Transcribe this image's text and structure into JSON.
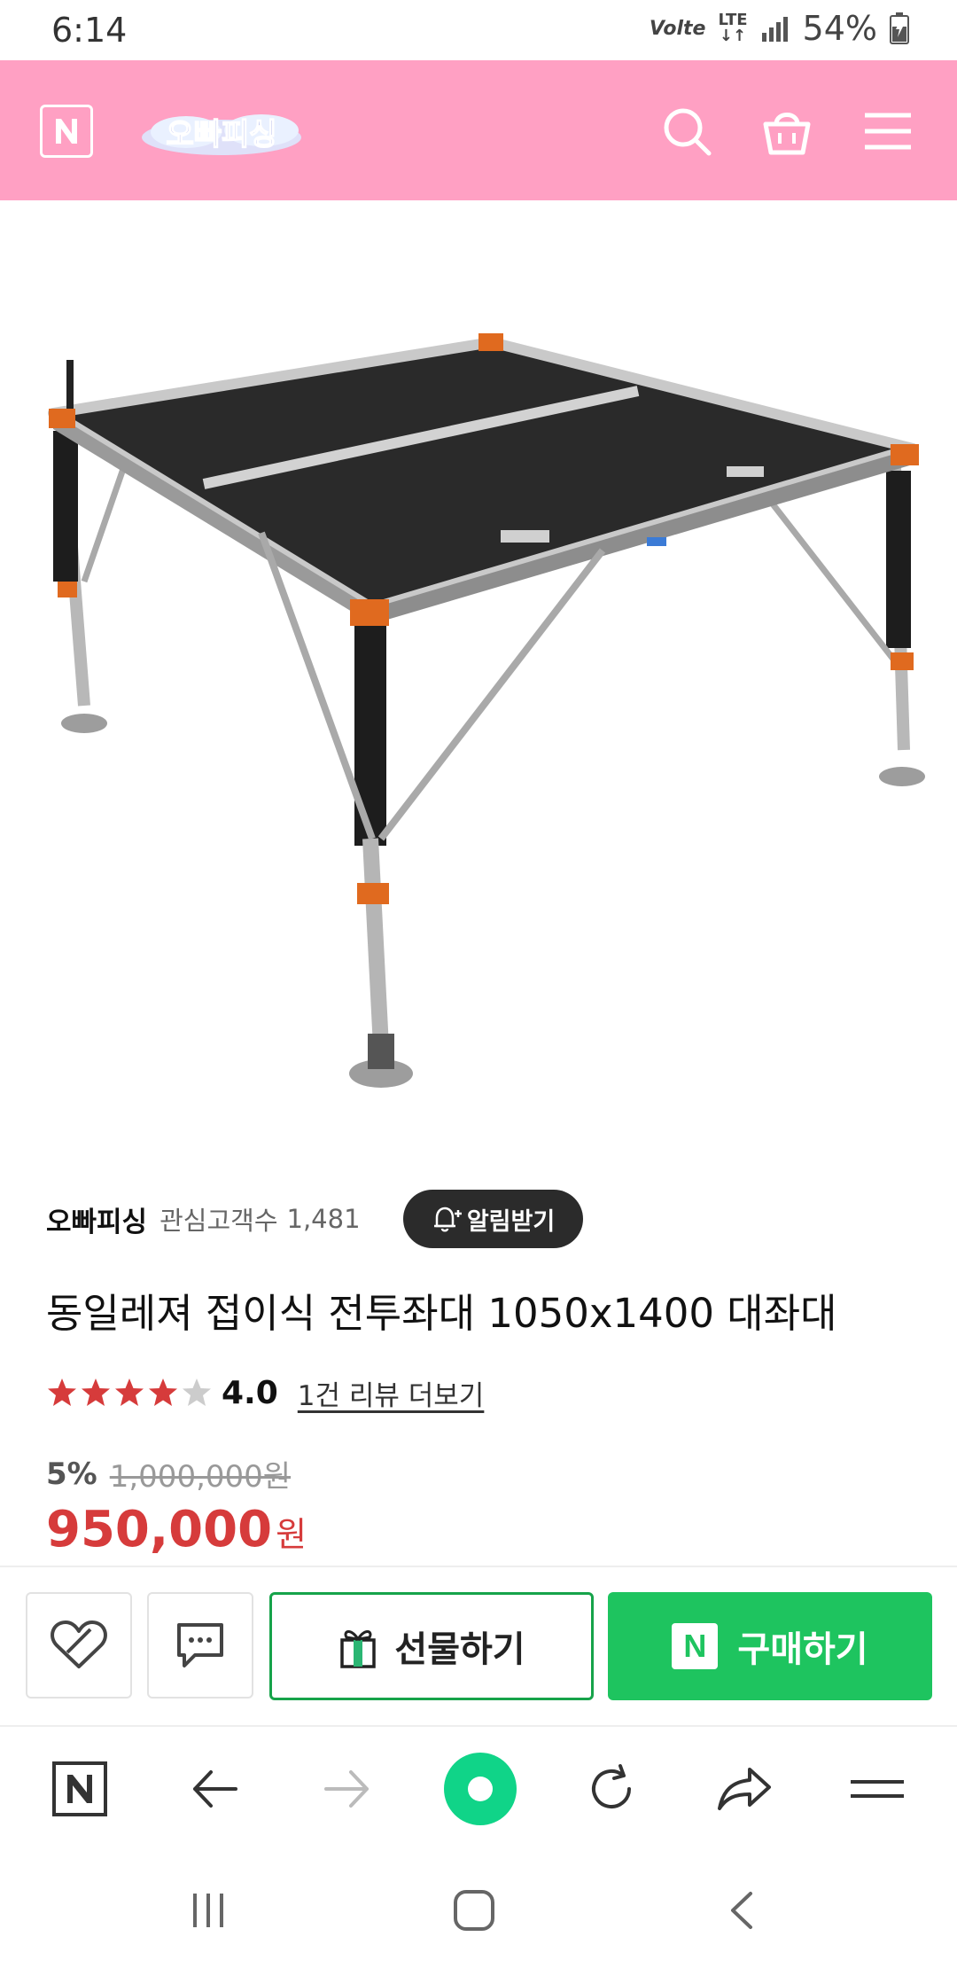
{
  "status_bar": {
    "time": "6:14",
    "volte": "Volte",
    "network": "LTE",
    "battery": "54%"
  },
  "header": {
    "logo_text": "오빠피싱",
    "n_label": "N"
  },
  "store": {
    "name": "오빠피싱",
    "interest_label": "관심고객수",
    "interest_count": "1,481",
    "alarm_label": "알림받기"
  },
  "product": {
    "title": "동일레져 접이식 전투좌대 1050x1400 대좌대",
    "rating": 4,
    "rating_text": "4.0",
    "review_link": "1건 리뷰 더보기",
    "discount": "5%",
    "original_price": "1,000,000원",
    "price": "950,000",
    "price_unit": "원"
  },
  "actions": {
    "gift_label": "선물하기",
    "buy_label": "구매하기",
    "buy_n": "N"
  },
  "colors": {
    "header_bg": "#ffa0c3",
    "price_red": "#d63b3b",
    "buy_green": "#1ec45f",
    "star": "#d63b3b"
  }
}
